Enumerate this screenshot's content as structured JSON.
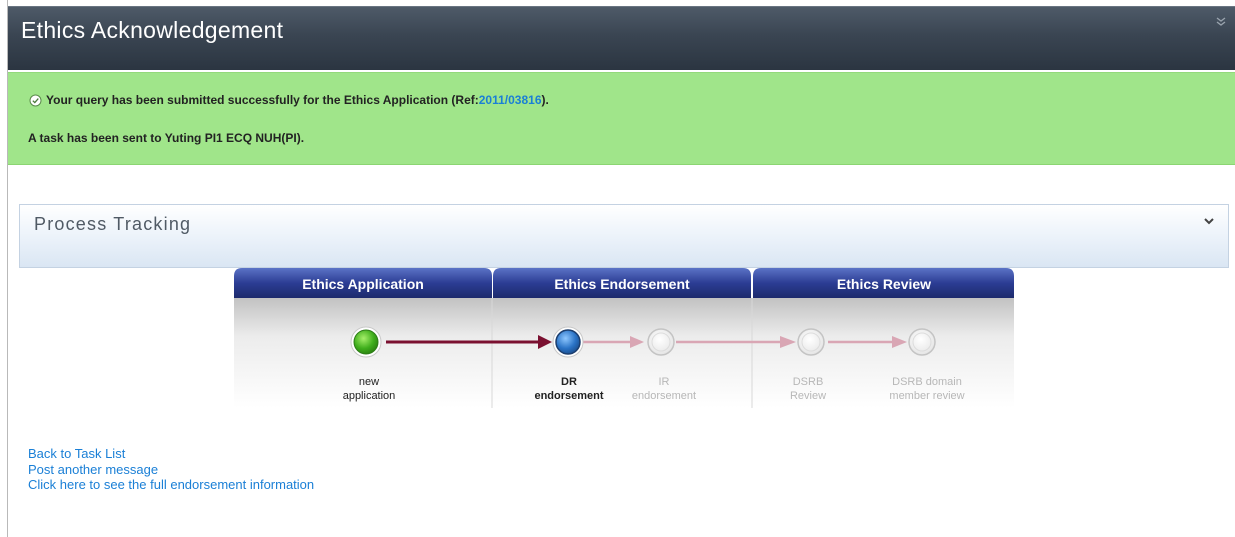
{
  "header": {
    "title": "Ethics Acknowledgement"
  },
  "banner": {
    "message_prefix": "Your query has been submitted successfully for the Ethics Application (Ref: ",
    "ref_link": "2011/03816",
    "message_suffix": ").",
    "task_message": "A task has been sent to Yuting PI1 ECQ NUH(PI)."
  },
  "process_tracking": {
    "title": "Process Tracking",
    "phases": [
      {
        "label": "Ethics Application"
      },
      {
        "label": "Ethics Endorsement"
      },
      {
        "label": "Ethics Review"
      }
    ],
    "steps": [
      {
        "line1": "new",
        "line2": "application",
        "status": "completed"
      },
      {
        "line1": "DR",
        "line2": "endorsement",
        "status": "current"
      },
      {
        "line1": "IR",
        "line2": "endorsement",
        "status": "pending"
      },
      {
        "line1": "DSRB",
        "line2": "Review",
        "status": "pending"
      },
      {
        "line1": "DSRB domain",
        "line2": "member review",
        "status": "pending"
      }
    ]
  },
  "links": {
    "back_to_task_list": "Back to Task List",
    "post_another_message": "Post another message",
    "full_endorsement_info": "Click here to see the full endorsement information"
  },
  "colors": {
    "header_bg": "#3a4552",
    "banner_bg": "#a0e58a",
    "link": "#1a7fd6",
    "tab_blue": "#2b3a8a",
    "completed_arrow": "#7a1030",
    "pending_arrow": "#d9a6b4"
  }
}
